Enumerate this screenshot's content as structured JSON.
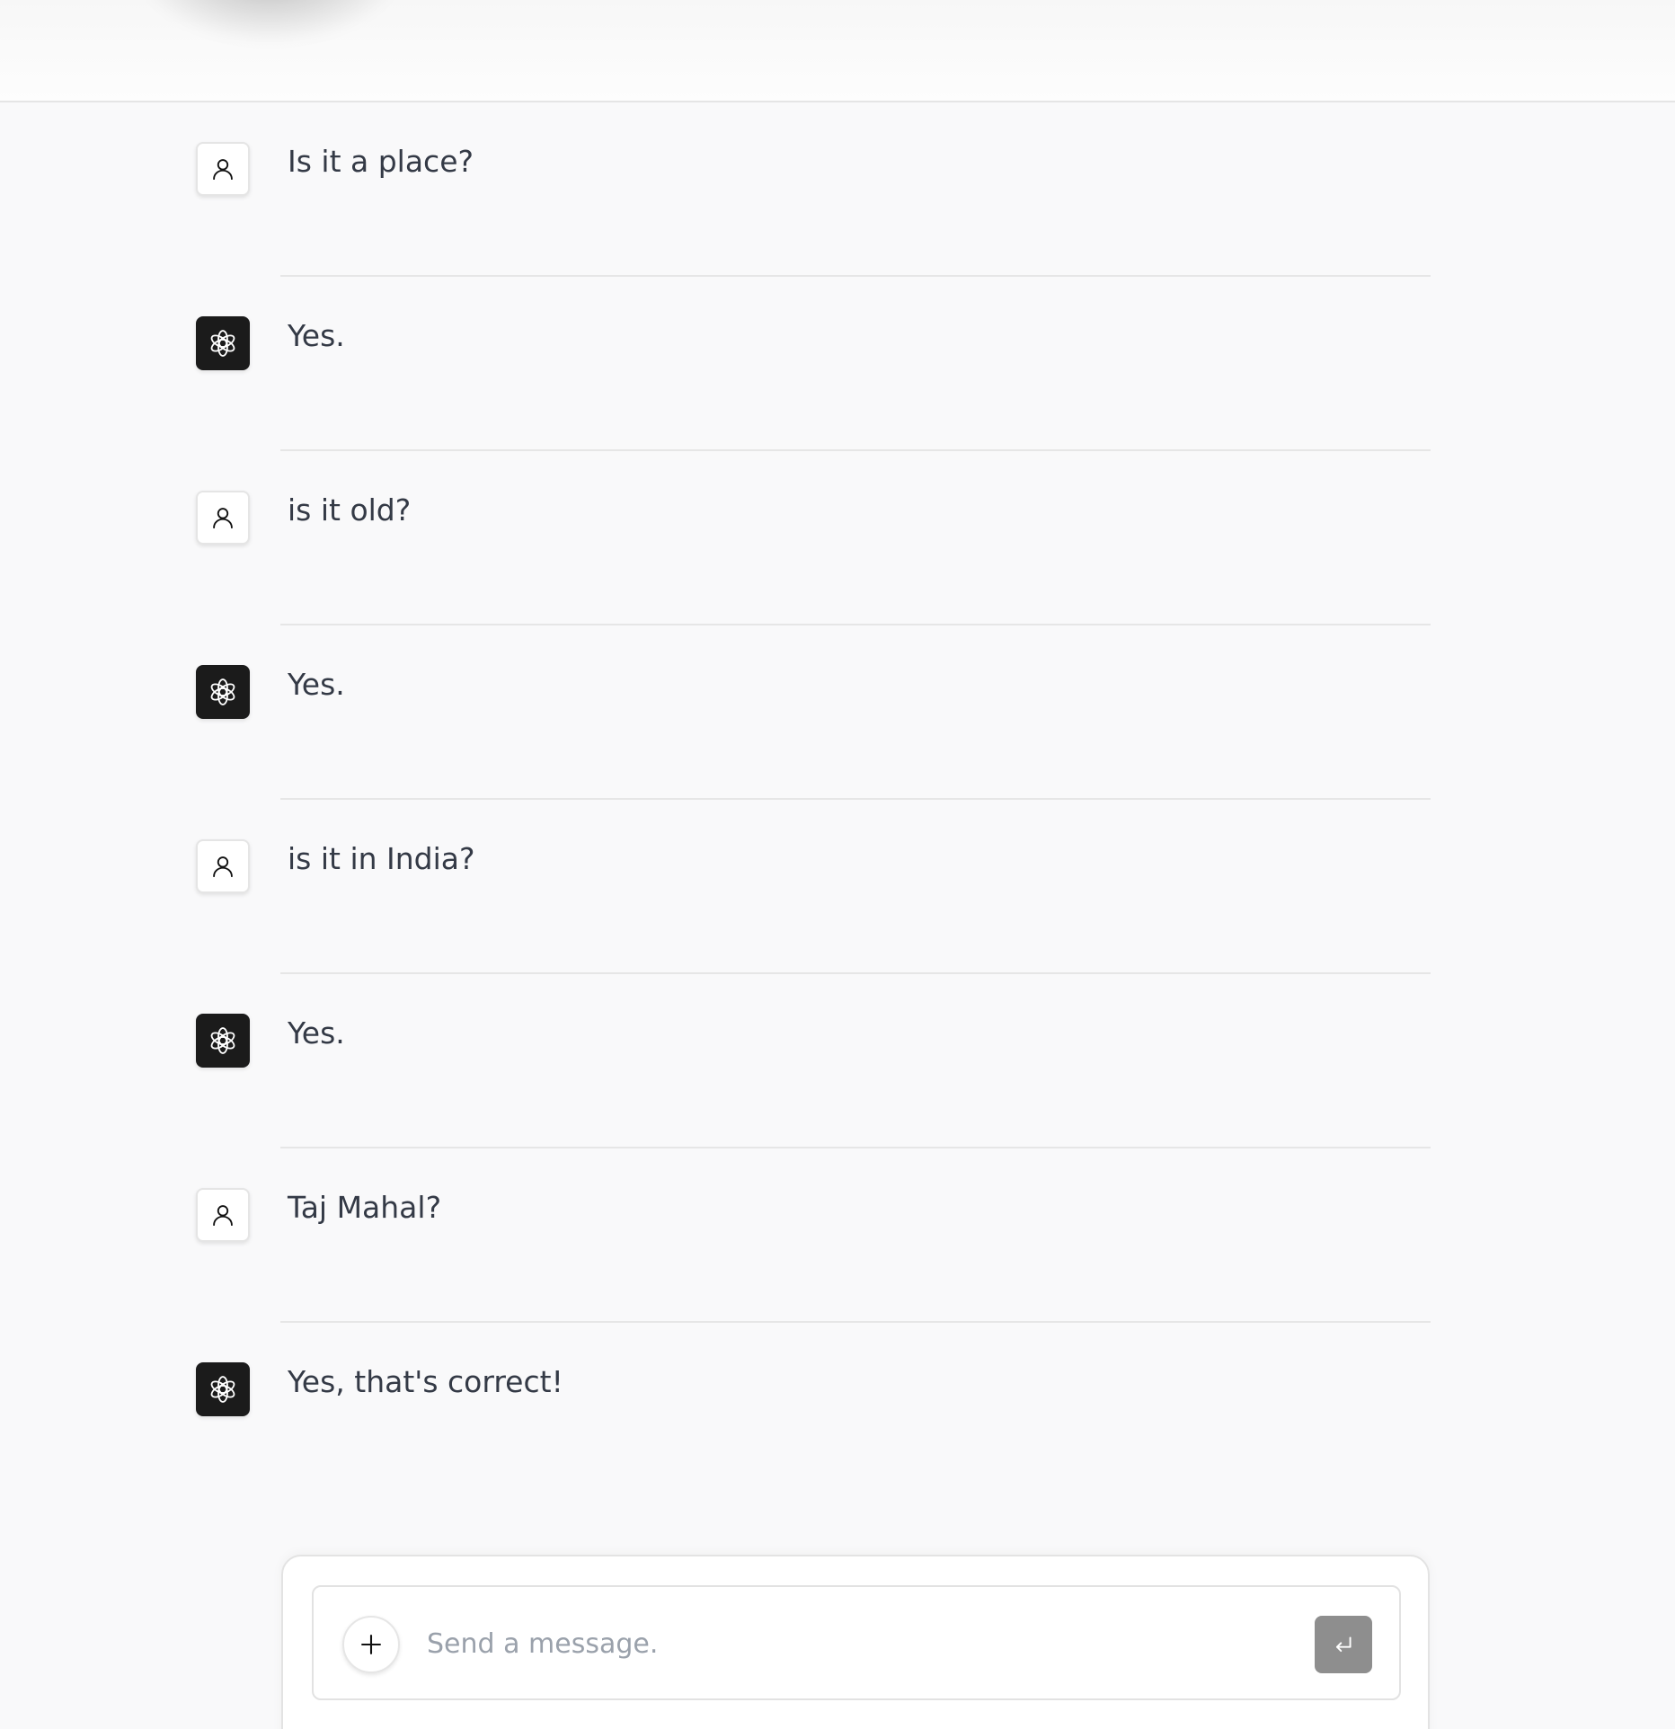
{
  "conversation": {
    "messages": [
      {
        "role": "user",
        "text": "Is it a place?",
        "avatar_icon": "user-icon"
      },
      {
        "role": "assistant",
        "text": "Yes.",
        "avatar_icon": "openai-logo-icon"
      },
      {
        "role": "user",
        "text": "is it old?",
        "avatar_icon": "user-icon"
      },
      {
        "role": "assistant",
        "text": "Yes.",
        "avatar_icon": "openai-logo-icon"
      },
      {
        "role": "user",
        "text": "is it in India?",
        "avatar_icon": "user-icon"
      },
      {
        "role": "assistant",
        "text": "Yes.",
        "avatar_icon": "openai-logo-icon"
      },
      {
        "role": "user",
        "text": "Taj Mahal?",
        "avatar_icon": "user-icon"
      },
      {
        "role": "assistant",
        "text": "Yes, that's correct!",
        "avatar_icon": "openai-logo-icon"
      }
    ]
  },
  "composer": {
    "placeholder": "Send a message.",
    "value": "",
    "attach_icon": "plus-icon",
    "send_icon": "enter-arrow-icon"
  },
  "colors": {
    "page_background": "#f9f9fa",
    "assistant_avatar_background": "#1b1b1b",
    "user_avatar_background": "#ffffff",
    "send_button_background": "#8e8e8e",
    "message_text": "#343a46"
  }
}
